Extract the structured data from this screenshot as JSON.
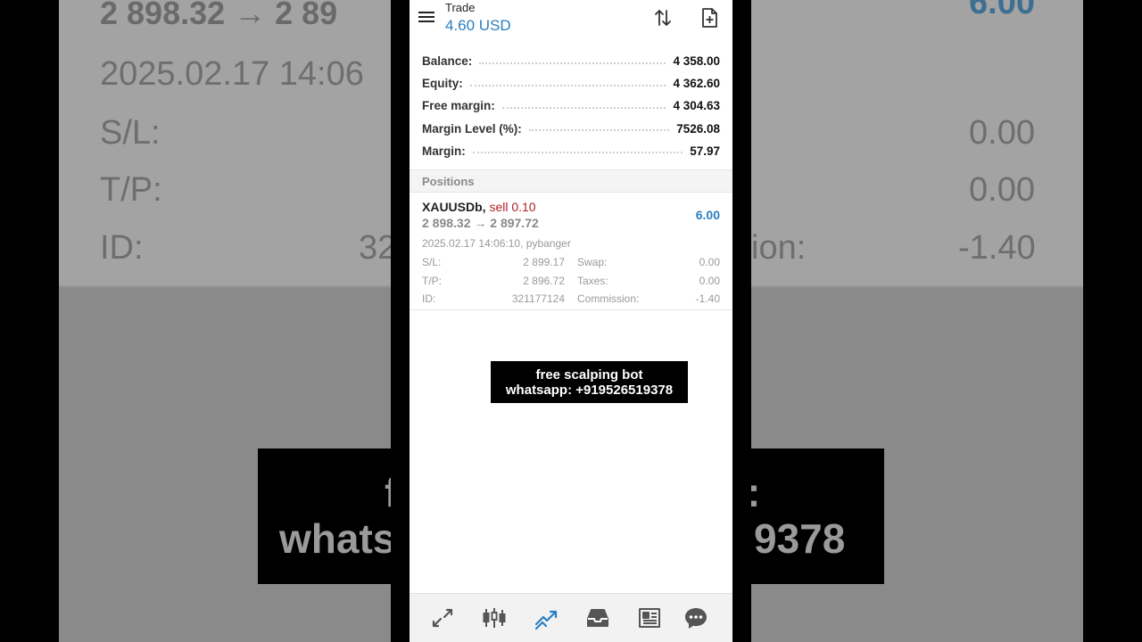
{
  "header": {
    "title": "Trade",
    "profit": "4.60 USD"
  },
  "account": {
    "rows": [
      {
        "label": "Balance:",
        "value": "4 358.00"
      },
      {
        "label": "Equity:",
        "value": "4 362.60"
      },
      {
        "label": "Free margin:",
        "value": "4 304.63"
      },
      {
        "label": "Margin Level (%):",
        "value": "7526.08"
      },
      {
        "label": "Margin:",
        "value": "57.97"
      }
    ]
  },
  "positions": {
    "title": "Positions",
    "items": [
      {
        "symbol": "XAUUSDb,",
        "type": "sell 0.10",
        "prices": "2 898.32 → 2 897.72",
        "profit": "6.00",
        "meta": "2025.02.17 14:06:10, pybanger",
        "sl_label": "S/L:",
        "sl": "2 899.17",
        "swap_label": "Swap:",
        "swap": "0.00",
        "tp_label": "T/P:",
        "tp": "2 896.72",
        "taxes_label": "Taxes:",
        "taxes": "0.00",
        "id_label": "ID:",
        "id": "321177124",
        "commission_label": "Commission:",
        "commission": "-1.40"
      }
    ]
  },
  "overlay": {
    "line1": "free scalping bot",
    "line2": "whatsapp: +919526519378"
  },
  "background": {
    "prices_fragment": "2 898.32 → 2 89",
    "date_fragment": "2025.02.17 14:06",
    "sl_label": "S/L:",
    "tp_label": "T/P:",
    "id_label": "ID:",
    "id_fragment": "32",
    "profit_fragment": "6.00",
    "swap": "0.00",
    "taxes": "0.00",
    "commission_fragment": "ion:",
    "commission": "-1.40",
    "overlay_fragment_1": "f",
    "overlay_fragment_2": ":",
    "overlay_fragment_3": "whats",
    "overlay_fragment_4": "9378"
  },
  "colors": {
    "accent": "#2a7fc1",
    "sell": "#b0202a",
    "nav_active": "#2a7fc1"
  },
  "nav": {
    "items": [
      {
        "icon": "quotes-icon"
      },
      {
        "icon": "chart-icon"
      },
      {
        "icon": "trade-icon",
        "active": true
      },
      {
        "icon": "history-icon"
      },
      {
        "icon": "news-icon"
      },
      {
        "icon": "messages-icon"
      }
    ]
  }
}
